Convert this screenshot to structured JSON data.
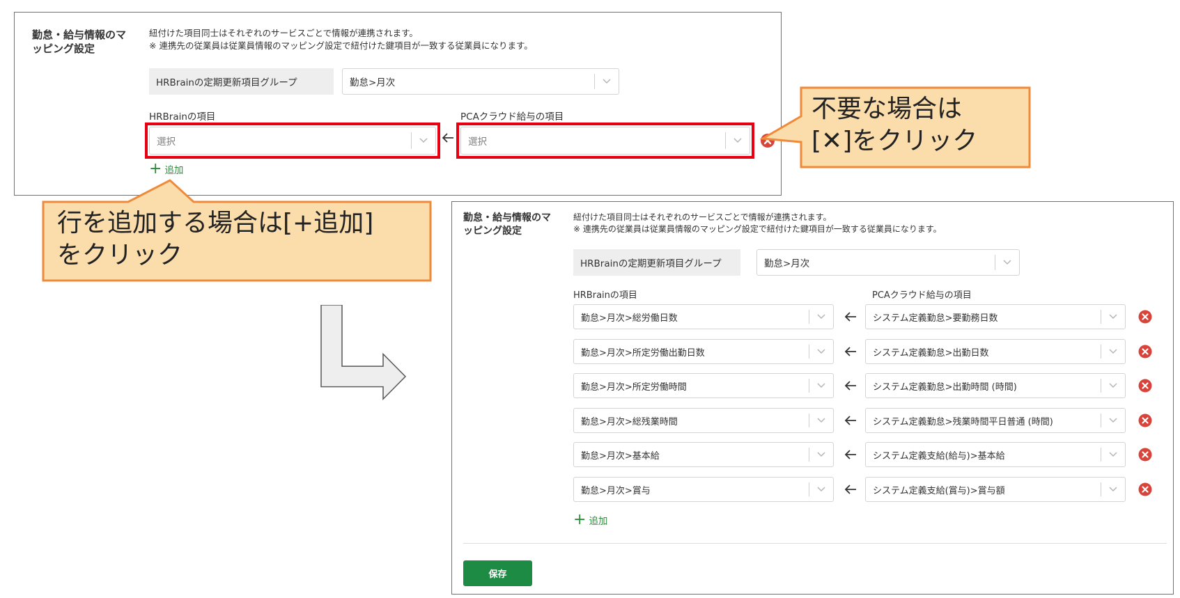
{
  "mapping": {
    "section_label_line1": "勤怠・給与情報のマ",
    "section_label_line2": "ッピング設定",
    "description_line1": "紐付けた項目同士はそれぞれのサービスごとで情報が連携されます。",
    "description_line2": "※ 連携先の従業員は従業員情報のマッピング設定で紐付けた鍵項目が一致する従業員になります。",
    "group_label": "HRBrainの定期更新項目グループ",
    "group_value": "勤怠>月次",
    "col_left": "HRBrainの項目",
    "col_right": "PCAクラウド給与の項目",
    "placeholder": "選択",
    "add_label": "追加",
    "save_label": "保存"
  },
  "rows": [
    {
      "left": "勤怠>月次>総労働日数",
      "right": "システム定義勤怠>要勤務日数"
    },
    {
      "left": "勤怠>月次>所定労働出勤日数",
      "right": "システム定義勤怠>出勤日数"
    },
    {
      "left": "勤怠>月次>所定労働時間",
      "right": "システム定義勤怠>出勤時間 (時間)"
    },
    {
      "left": "勤怠>月次>総残業時間",
      "right": "システム定義勤怠>残業時間平日普通 (時間)"
    },
    {
      "left": "勤怠>月次>基本給",
      "right": "システム定義支給(給与)>基本給"
    },
    {
      "left": "勤怠>月次>賞与",
      "right": "システム定義支給(賞与)>賞与額"
    }
  ],
  "callouts": {
    "remove_line1": "不要な場合は",
    "remove_line2": "[✕]をクリック",
    "add_line1": "行を追加する場合は[+追加]",
    "add_line2": "をクリック"
  },
  "colors": {
    "callout_fill": "#fbdcab",
    "callout_border": "#ef8a3a",
    "highlight": "#e60012",
    "save_button": "#1e8b45",
    "remove_icon": "#d9443a",
    "add_link": "#2e8b3c"
  },
  "icons": [
    "chevron-down-icon",
    "arrow-left-icon",
    "remove-circle-icon",
    "plus-icon",
    "flow-arrow-icon"
  ]
}
